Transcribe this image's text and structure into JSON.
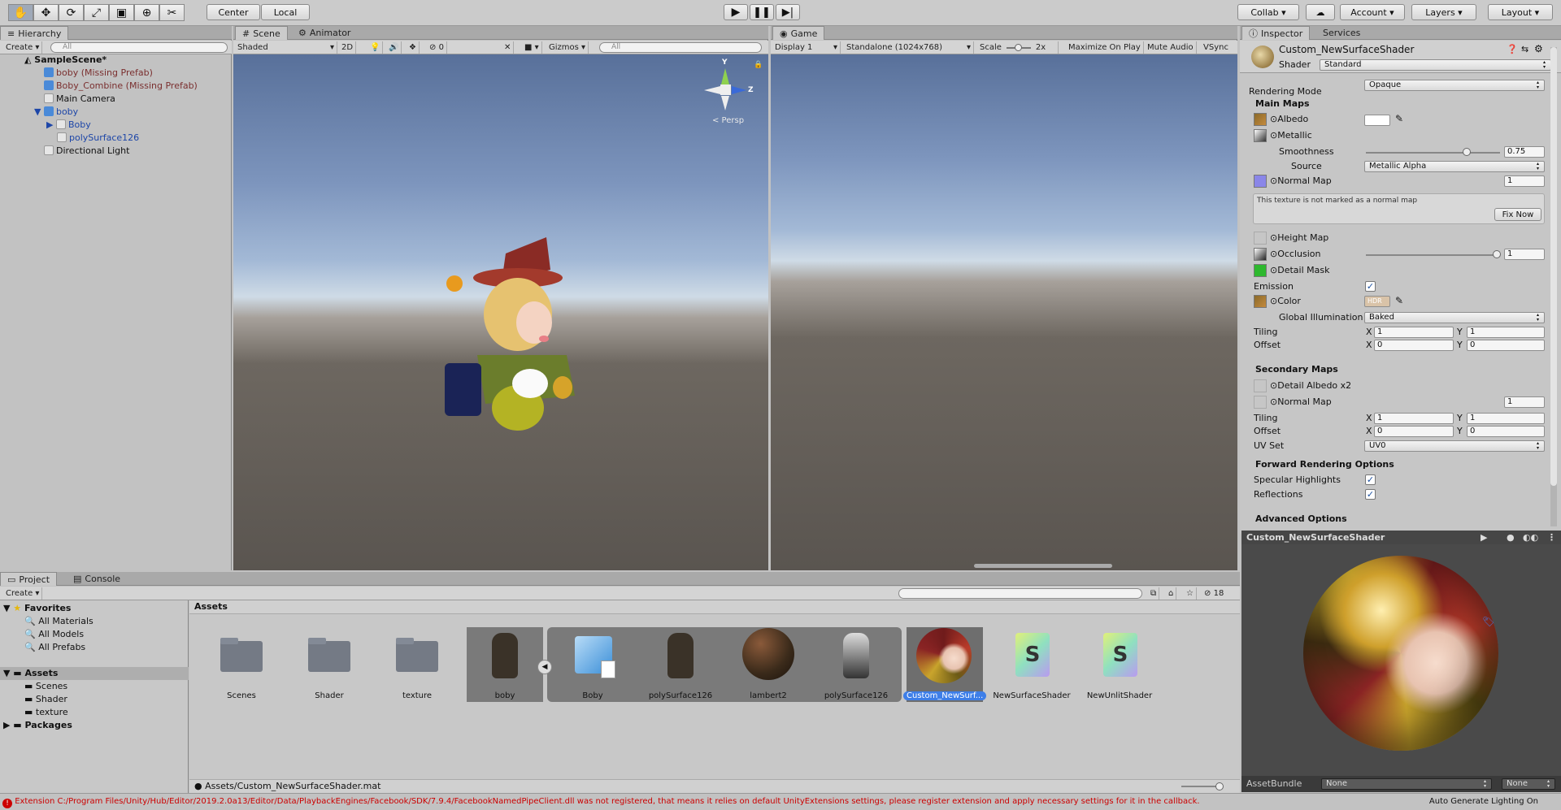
{
  "toolbar": {
    "pivot": "Center",
    "space": "Local",
    "collab": "Collab",
    "account": "Account",
    "layers": "Layers",
    "layout": "Layout"
  },
  "hierarchy": {
    "tab": "Hierarchy",
    "create": "Create",
    "search_placeholder": "All",
    "scene": "SampleScene*",
    "items": [
      "boby (Missing Prefab)",
      "Boby_Combine (Missing Prefab)",
      "Main Camera",
      "boby",
      "Boby",
      "polySurface126",
      "Directional Light"
    ]
  },
  "scene": {
    "tab_scene": "Scene",
    "tab_animator": "Animator",
    "shading": "Shaded",
    "mode2d": "2D",
    "fx_count": "0",
    "gizmos": "Gizmos",
    "search_placeholder": "All",
    "persp": "< Persp",
    "axis_y": "Y",
    "axis_z": "Z"
  },
  "game": {
    "tab": "Game",
    "display": "Display 1",
    "resolution": "Standalone (1024x768)",
    "scale_label": "Scale",
    "scale_value": "2x",
    "maximize": "Maximize On Play",
    "mute": "Mute Audio",
    "vsync": "VSync"
  },
  "inspector": {
    "tab": "Inspector",
    "tab_services": "Services",
    "material_name": "Custom_NewSurfaceShader",
    "shader_label": "Shader",
    "shader_value": "Standard",
    "rendering_mode_label": "Rendering Mode",
    "rendering_mode_value": "Opaque",
    "main_maps": "Main Maps",
    "albedo": "Albedo",
    "metallic": "Metallic",
    "smoothness": "Smoothness",
    "smoothness_value": "0.75",
    "smoothness_level": 0.75,
    "source": "Source",
    "source_value": "Metallic Alpha",
    "normal_map": "Normal Map",
    "normal_value": "1",
    "warning": "This texture is not marked as a normal map",
    "fix_now": "Fix Now",
    "height_map": "Height Map",
    "occlusion": "Occlusion",
    "occlusion_value": "1",
    "detail_mask": "Detail Mask",
    "emission": "Emission",
    "color": "Color",
    "hdr": "HDR",
    "gi_label": "Global Illumination",
    "gi_value": "Baked",
    "tiling": "Tiling",
    "offset": "Offset",
    "x": "X",
    "y": "Y",
    "tiling_x": "1",
    "tiling_y": "1",
    "offset_x": "0",
    "offset_y": "0",
    "secondary_maps": "Secondary Maps",
    "detail_albedo": "Detail Albedo x2",
    "normal_map2": "Normal Map",
    "normal_value2": "1",
    "tiling2_x": "1",
    "tiling2_y": "1",
    "offset2_x": "0",
    "offset2_y": "0",
    "uv_set": "UV Set",
    "uv_value": "UV0",
    "forward": "Forward Rendering Options",
    "specular": "Specular Highlights",
    "reflections": "Reflections",
    "advanced": "Advanced Options",
    "preview_title": "Custom_NewSurfaceShader",
    "assetbundle": "AssetBundle",
    "ab_none1": "None",
    "ab_none2": "None"
  },
  "project": {
    "tab": "Project",
    "tab_console": "Console",
    "create": "Create",
    "hidden_count": "18",
    "favorites": "Favorites",
    "fav_items": [
      "All Materials",
      "All Models",
      "All Prefabs"
    ],
    "assets": "Assets",
    "asset_folders": [
      "Scenes",
      "Shader",
      "texture"
    ],
    "packages": "Packages",
    "breadcrumb": "Assets",
    "path": "Assets/Custom_NewSurfaceShader.mat",
    "grid": [
      "Scenes",
      "Shader",
      "texture",
      "boby",
      "Boby",
      "polySurface126",
      "lambert2",
      "polySurface126",
      "Custom_NewSurf...",
      "NewSurfaceShader",
      "NewUnlitShader"
    ]
  },
  "status": {
    "message": "Extension C:/Program Files/Unity/Hub/Editor/2019.2.0a13/Editor/Data/PlaybackEngines/Facebook/SDK/7.9.4/FacebookNamedPipeClient.dll was not registered, that means it relies on default UnityExtensions settings, please register extension and apply necessary settings for it in the callback.",
    "right": "Auto Generate Lighting On"
  },
  "colors": {
    "accent": "#3d7ee8",
    "sky": "#8aa6d1",
    "ground": "#5a5550",
    "error": "#cc0000"
  }
}
